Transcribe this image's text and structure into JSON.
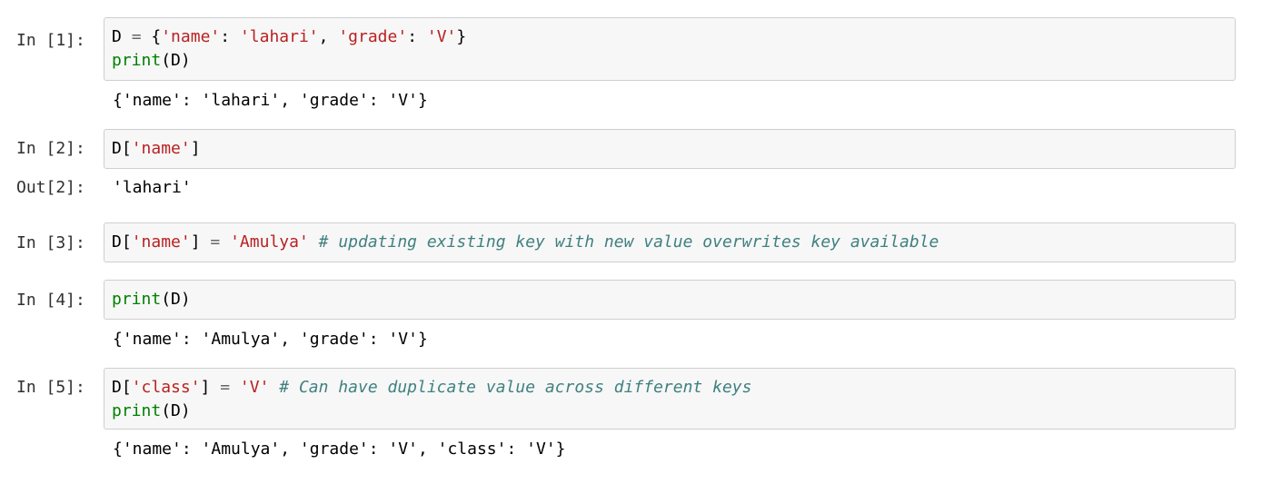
{
  "cells": [
    {
      "prompt": "In [1]:",
      "code": [
        [
          {
            "t": "D",
            "k": "name"
          },
          {
            "t": " ",
            "k": "default"
          },
          {
            "t": "=",
            "k": "op"
          },
          {
            "t": " {",
            "k": "default"
          },
          {
            "t": "'name'",
            "k": "string"
          },
          {
            "t": ": ",
            "k": "default"
          },
          {
            "t": "'lahari'",
            "k": "string"
          },
          {
            "t": ", ",
            "k": "default"
          },
          {
            "t": "'grade'",
            "k": "string"
          },
          {
            "t": ": ",
            "k": "default"
          },
          {
            "t": "'V'",
            "k": "string"
          },
          {
            "t": "}",
            "k": "default"
          }
        ],
        [
          {
            "t": "print",
            "k": "builtin"
          },
          {
            "t": "(D)",
            "k": "default"
          }
        ]
      ],
      "output_prompt": "",
      "output": "{'name': 'lahari', 'grade': 'V'}"
    },
    {
      "prompt": "In [2]:",
      "code": [
        [
          {
            "t": "D[",
            "k": "default"
          },
          {
            "t": "'name'",
            "k": "string"
          },
          {
            "t": "]",
            "k": "default"
          }
        ]
      ],
      "output_prompt": "Out[2]:",
      "output": "'lahari'"
    },
    {
      "prompt": "In [3]:",
      "code": [
        [
          {
            "t": "D[",
            "k": "default"
          },
          {
            "t": "'name'",
            "k": "string"
          },
          {
            "t": "] ",
            "k": "default"
          },
          {
            "t": "=",
            "k": "op"
          },
          {
            "t": " ",
            "k": "default"
          },
          {
            "t": "'Amulya'",
            "k": "string"
          },
          {
            "t": " ",
            "k": "default"
          },
          {
            "t": "# updating existing key with new value overwrites key available",
            "k": "comment"
          }
        ]
      ],
      "output_prompt": "",
      "output": ""
    },
    {
      "prompt": "In [4]:",
      "code": [
        [
          {
            "t": "print",
            "k": "builtin"
          },
          {
            "t": "(D)",
            "k": "default"
          }
        ]
      ],
      "output_prompt": "",
      "output": "{'name': 'Amulya', 'grade': 'V'}"
    },
    {
      "prompt": "In [5]:",
      "code": [
        [
          {
            "t": "D[",
            "k": "default"
          },
          {
            "t": "'class'",
            "k": "string"
          },
          {
            "t": "] ",
            "k": "default"
          },
          {
            "t": "=",
            "k": "op"
          },
          {
            "t": " ",
            "k": "default"
          },
          {
            "t": "'V'",
            "k": "string"
          },
          {
            "t": " ",
            "k": "default"
          },
          {
            "t": "# Can have duplicate value across different keys",
            "k": "comment"
          }
        ],
        [
          {
            "t": "print",
            "k": "builtin"
          },
          {
            "t": "(D)",
            "k": "default"
          }
        ]
      ],
      "output_prompt": "",
      "output": "{'name': 'Amulya', 'grade': 'V', 'class': 'V'}"
    }
  ]
}
